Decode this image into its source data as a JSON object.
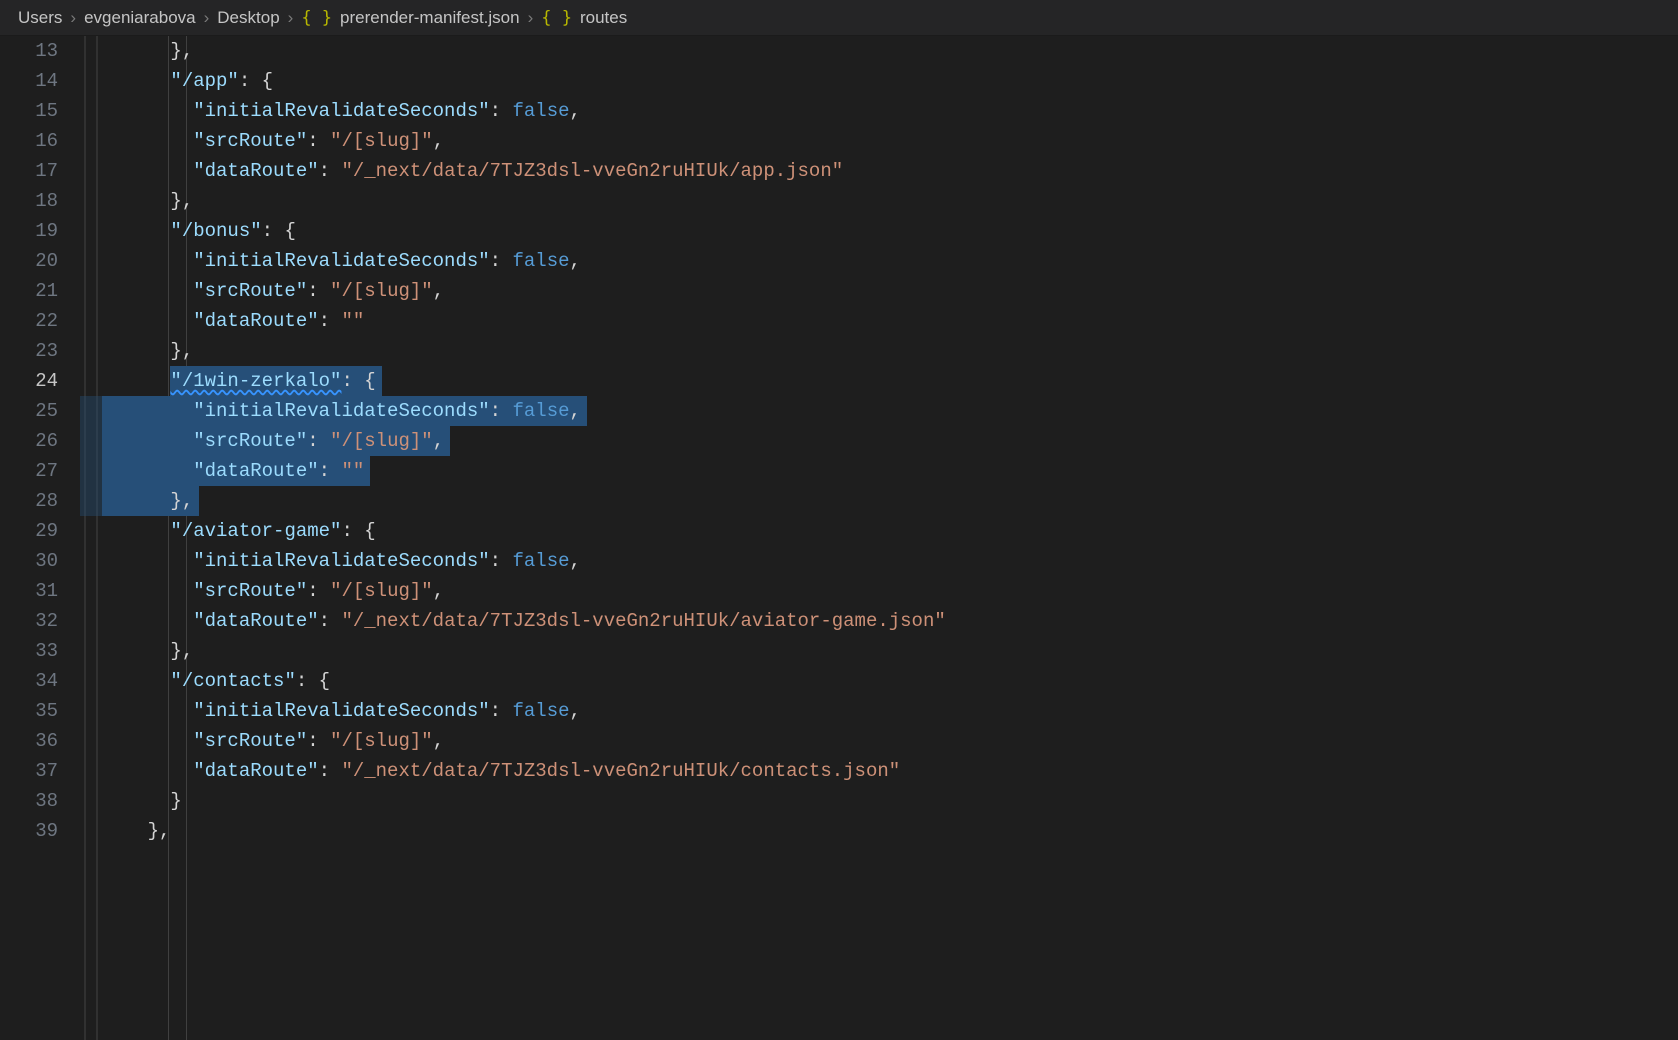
{
  "breadcrumb": {
    "items": [
      "Users",
      "evgeniarabova",
      "Desktop"
    ],
    "file": "prerender-manifest.json",
    "symbol": "routes"
  },
  "line_numbers": [
    "13",
    "14",
    "15",
    "16",
    "17",
    "18",
    "19",
    "20",
    "21",
    "22",
    "23",
    "24",
    "25",
    "26",
    "27",
    "28",
    "29",
    "30",
    "31",
    "32",
    "33",
    "34",
    "35",
    "36",
    "37",
    "38",
    "39"
  ],
  "current_line": "24",
  "selection": {
    "start_line": "24",
    "end_line": "28"
  },
  "code": {
    "routes": {
      "/app": {
        "initialRevalidateSeconds": false,
        "srcRoute": "/[slug]",
        "dataRoute": "/_next/data/7TJZ3dsl-vveGn2ruHIUk/app.json"
      },
      "/bonus": {
        "initialRevalidateSeconds": false,
        "srcRoute": "/[slug]",
        "dataRoute": ""
      },
      "/1win-zerkalo": {
        "initialRevalidateSeconds": false,
        "srcRoute": "/[slug]",
        "dataRoute": ""
      },
      "/aviator-game": {
        "initialRevalidateSeconds": false,
        "srcRoute": "/[slug]",
        "dataRoute": "/_next/data/7TJZ3dsl-vveGn2ruHIUk/aviator-game.json"
      },
      "/contacts": {
        "initialRevalidateSeconds": false,
        "srcRoute": "/[slug]",
        "dataRoute": "/_next/data/7TJZ3dsl-vveGn2ruHIUk/contacts.json"
      }
    }
  },
  "lines": [
    {
      "n": "13",
      "tokens": [
        [
          "punct",
          "      "
        ],
        [
          "brace",
          "}"
        ],
        [
          "punct",
          ","
        ]
      ]
    },
    {
      "n": "14",
      "tokens": [
        [
          "punct",
          "      "
        ],
        [
          "key",
          "\"/app\""
        ],
        [
          "punct",
          ": "
        ],
        [
          "brace",
          "{"
        ]
      ]
    },
    {
      "n": "15",
      "tokens": [
        [
          "punct",
          "        "
        ],
        [
          "key",
          "\"initialRevalidateSeconds\""
        ],
        [
          "punct",
          ": "
        ],
        [
          "bool",
          "false"
        ],
        [
          "punct",
          ","
        ]
      ]
    },
    {
      "n": "16",
      "tokens": [
        [
          "punct",
          "        "
        ],
        [
          "key",
          "\"srcRoute\""
        ],
        [
          "punct",
          ": "
        ],
        [
          "str",
          "\"/[slug]\""
        ],
        [
          "punct",
          ","
        ]
      ]
    },
    {
      "n": "17",
      "tokens": [
        [
          "punct",
          "        "
        ],
        [
          "key",
          "\"dataRoute\""
        ],
        [
          "punct",
          ": "
        ],
        [
          "str",
          "\"/_next/data/7TJZ3dsl-vveGn2ruHIUk/app.json\""
        ]
      ]
    },
    {
      "n": "18",
      "tokens": [
        [
          "punct",
          "      "
        ],
        [
          "brace",
          "}"
        ],
        [
          "punct",
          ","
        ]
      ]
    },
    {
      "n": "19",
      "tokens": [
        [
          "punct",
          "      "
        ],
        [
          "key",
          "\"/bonus\""
        ],
        [
          "punct",
          ": "
        ],
        [
          "brace",
          "{"
        ]
      ]
    },
    {
      "n": "20",
      "tokens": [
        [
          "punct",
          "        "
        ],
        [
          "key",
          "\"initialRevalidateSeconds\""
        ],
        [
          "punct",
          ": "
        ],
        [
          "bool",
          "false"
        ],
        [
          "punct",
          ","
        ]
      ]
    },
    {
      "n": "21",
      "tokens": [
        [
          "punct",
          "        "
        ],
        [
          "key",
          "\"srcRoute\""
        ],
        [
          "punct",
          ": "
        ],
        [
          "str",
          "\"/[slug]\""
        ],
        [
          "punct",
          ","
        ]
      ]
    },
    {
      "n": "22",
      "tokens": [
        [
          "punct",
          "        "
        ],
        [
          "key",
          "\"dataRoute\""
        ],
        [
          "punct",
          ": "
        ],
        [
          "str",
          "\"\""
        ]
      ]
    },
    {
      "n": "23",
      "tokens": [
        [
          "punct",
          "      "
        ],
        [
          "brace",
          "}"
        ],
        [
          "punct",
          ","
        ]
      ]
    },
    {
      "n": "24",
      "tokens": [
        [
          "punct",
          "      "
        ],
        [
          "keysq",
          "\"/1win-zerkalo\""
        ],
        [
          "punct",
          ": "
        ],
        [
          "brace",
          "{"
        ]
      ],
      "sel": true,
      "sel_from": 0,
      "sel_to": 320
    },
    {
      "n": "25",
      "tokens": [
        [
          "punct",
          "        "
        ],
        [
          "key",
          "\"initialRevalidateSeconds\""
        ],
        [
          "punct",
          ": "
        ],
        [
          "bool",
          "false"
        ],
        [
          "punct",
          ","
        ]
      ],
      "sel": true,
      "sel_from": 0,
      "sel_to": 510
    },
    {
      "n": "26",
      "tokens": [
        [
          "punct",
          "        "
        ],
        [
          "key",
          "\"srcRoute\""
        ],
        [
          "punct",
          ": "
        ],
        [
          "str",
          "\"/[slug]\""
        ],
        [
          "punct",
          ","
        ]
      ],
      "sel": true,
      "sel_from": 0,
      "sel_to": 350
    },
    {
      "n": "27",
      "tokens": [
        [
          "punct",
          "        "
        ],
        [
          "key",
          "\"dataRoute\""
        ],
        [
          "punct",
          ": "
        ],
        [
          "str",
          "\"\""
        ]
      ],
      "sel": true,
      "sel_from": 0,
      "sel_to": 300
    },
    {
      "n": "28",
      "tokens": [
        [
          "punct",
          "      "
        ],
        [
          "brace",
          "}"
        ],
        [
          "punct",
          ","
        ]
      ],
      "sel": true,
      "sel_from": 0,
      "sel_to": 100
    },
    {
      "n": "29",
      "tokens": [
        [
          "punct",
          "      "
        ],
        [
          "key",
          "\"/aviator-game\""
        ],
        [
          "punct",
          ": "
        ],
        [
          "brace",
          "{"
        ]
      ]
    },
    {
      "n": "30",
      "tokens": [
        [
          "punct",
          "        "
        ],
        [
          "key",
          "\"initialRevalidateSeconds\""
        ],
        [
          "punct",
          ": "
        ],
        [
          "bool",
          "false"
        ],
        [
          "punct",
          ","
        ]
      ]
    },
    {
      "n": "31",
      "tokens": [
        [
          "punct",
          "        "
        ],
        [
          "key",
          "\"srcRoute\""
        ],
        [
          "punct",
          ": "
        ],
        [
          "str",
          "\"/[slug]\""
        ],
        [
          "punct",
          ","
        ]
      ]
    },
    {
      "n": "32",
      "tokens": [
        [
          "punct",
          "        "
        ],
        [
          "key",
          "\"dataRoute\""
        ],
        [
          "punct",
          ": "
        ],
        [
          "str",
          "\"/_next/data/7TJZ3dsl-vveGn2ruHIUk/aviator-game.json\""
        ]
      ]
    },
    {
      "n": "33",
      "tokens": [
        [
          "punct",
          "      "
        ],
        [
          "brace",
          "}"
        ],
        [
          "punct",
          ","
        ]
      ]
    },
    {
      "n": "34",
      "tokens": [
        [
          "punct",
          "      "
        ],
        [
          "key",
          "\"/contacts\""
        ],
        [
          "punct",
          ": "
        ],
        [
          "brace",
          "{"
        ]
      ]
    },
    {
      "n": "35",
      "tokens": [
        [
          "punct",
          "        "
        ],
        [
          "key",
          "\"initialRevalidateSeconds\""
        ],
        [
          "punct",
          ": "
        ],
        [
          "bool",
          "false"
        ],
        [
          "punct",
          ","
        ]
      ]
    },
    {
      "n": "36",
      "tokens": [
        [
          "punct",
          "        "
        ],
        [
          "key",
          "\"srcRoute\""
        ],
        [
          "punct",
          ": "
        ],
        [
          "str",
          "\"/[slug]\""
        ],
        [
          "punct",
          ","
        ]
      ]
    },
    {
      "n": "37",
      "tokens": [
        [
          "punct",
          "        "
        ],
        [
          "key",
          "\"dataRoute\""
        ],
        [
          "punct",
          ": "
        ],
        [
          "str",
          "\"/_next/data/7TJZ3dsl-vveGn2ruHIUk/contacts.json\""
        ]
      ]
    },
    {
      "n": "38",
      "tokens": [
        [
          "punct",
          "      "
        ],
        [
          "brace",
          "}"
        ]
      ]
    },
    {
      "n": "39",
      "tokens": [
        [
          "punct",
          "    "
        ],
        [
          "brace",
          "}"
        ],
        [
          "punct",
          ","
        ]
      ]
    }
  ]
}
